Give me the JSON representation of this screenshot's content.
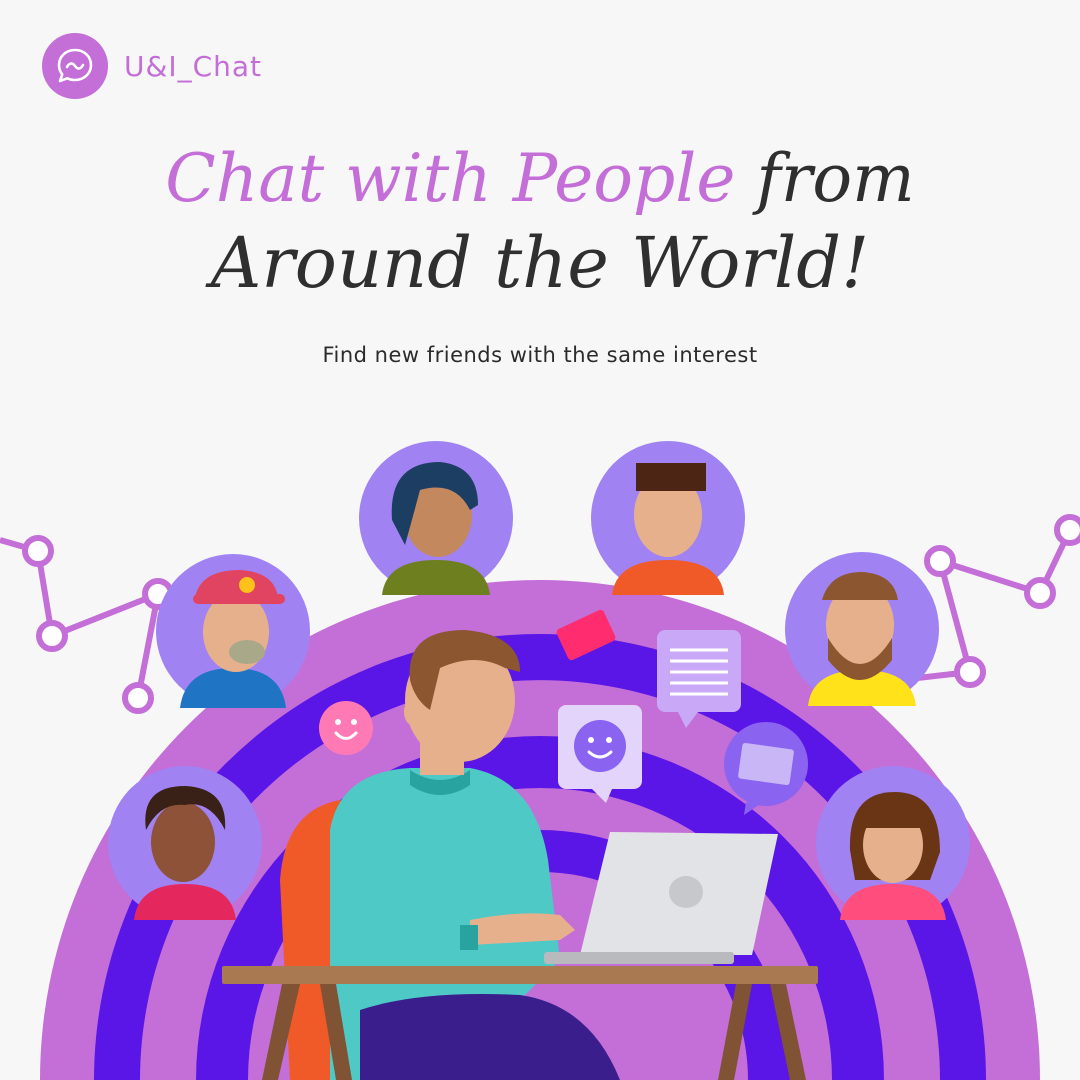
{
  "brand": {
    "name": "U&I_Chat",
    "icon": "chat-bubble-icon",
    "color": "#c46ed8"
  },
  "headline": {
    "accent_text": "Chat with People",
    "rest_text": "from",
    "line2": "Around the World!"
  },
  "subtitle": "Find new friends with the same interest",
  "colors": {
    "purple_light": "#c46ed8",
    "purple_deep": "#5a16e6",
    "avatar_circle": "#a182f3",
    "background": "#f7f7f7"
  }
}
